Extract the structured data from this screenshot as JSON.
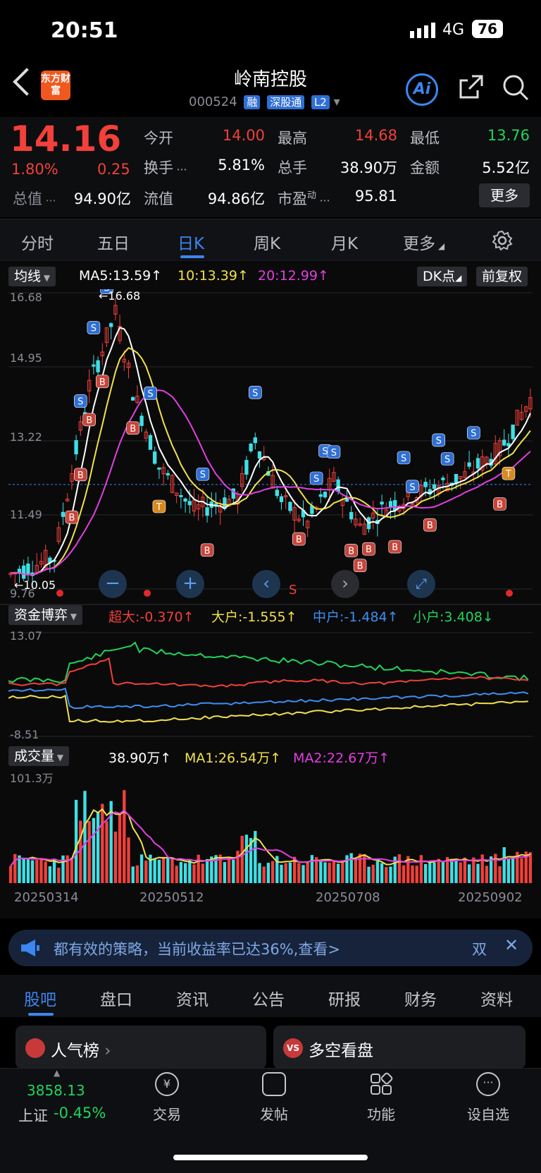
{
  "status_bar": {
    "time": "20:51",
    "network": "4G",
    "battery": "76"
  },
  "header": {
    "logo_text": "东方财富",
    "stock_name": "岭南控股",
    "code": "000524",
    "tags": [
      "融",
      "深股通",
      "L2"
    ],
    "ai_label": "Ai"
  },
  "quote": {
    "price": "14.16",
    "change_pct": "1.80%",
    "change_amt": "0.25",
    "open_label": "今开",
    "open": "14.00",
    "high_label": "最高",
    "high": "14.68",
    "low_label": "最低",
    "low": "13.76",
    "turnover_label": "换手",
    "turnover": "5.81%",
    "volume_label": "总手",
    "volume": "38.90万",
    "amount_label": "金额",
    "amount": "5.52亿",
    "mktcap_label": "总值",
    "mktcap": "94.90亿",
    "float_label": "流值",
    "float_cap": "94.86亿",
    "pe_label": "市盈",
    "pe_sup": "动",
    "pe": "95.81",
    "more": "更多"
  },
  "period_tabs": [
    "分时",
    "五日",
    "日K",
    "周K",
    "月K",
    "更多"
  ],
  "active_tab": "日K",
  "kline": {
    "indicator": "均线",
    "ma5": "MA5:13.59",
    "ma10": "10:13.39",
    "ma20": "20:12.99",
    "dk": "DK点",
    "adjust": "前复权",
    "axis": [
      "16.68",
      "14.95",
      "13.22",
      "11.49",
      "9.76"
    ],
    "high_marker": "16.68",
    "low_marker": "10.05",
    "s_marker": "S"
  },
  "flow": {
    "indicator": "资金博弈",
    "super": "超大:-0.370",
    "large": "大户:-1.555",
    "mid": "中户:-1.484",
    "small": "小户:3.408",
    "axis_top": "13.07",
    "axis_bottom": "-8.51"
  },
  "volume_panel": {
    "indicator": "成交量",
    "vol": "38.90万",
    "ma1": "MA1:26.54万",
    "ma2": "MA2:22.67万",
    "axis_top": "101.3万",
    "dates": [
      "20250314",
      "20250512",
      "20250708",
      "20250902"
    ]
  },
  "ticker": {
    "text": "都有效的策略，当前收益率已达36%,查看>",
    "right": "双"
  },
  "sub_tabs": [
    "股吧",
    "盘口",
    "资讯",
    "公告",
    "研报",
    "财务",
    "资料"
  ],
  "cards": [
    "人气榜",
    "多空看盘"
  ],
  "nav": {
    "index_value": "3858.13",
    "index_name": "上证",
    "index_change": "-0.45%",
    "items": [
      "交易",
      "发帖",
      "功能",
      "设自选"
    ]
  },
  "colors": {
    "up": "#f2403a",
    "down": "#20d45a",
    "accent": "#3b86f0",
    "ma5": "#ffffff",
    "ma10": "#f1e14a",
    "ma20": "#e23fe0"
  }
}
